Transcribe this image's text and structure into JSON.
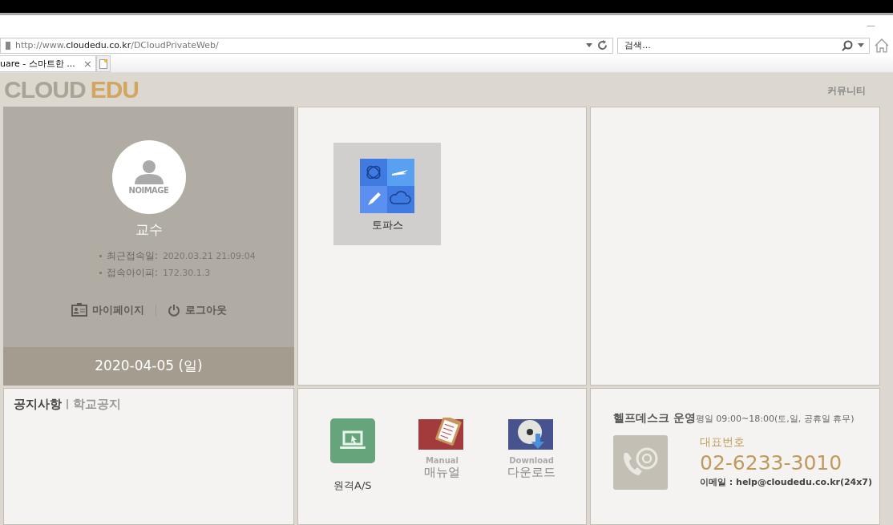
{
  "browser": {
    "minimize": "—",
    "url": "http://www.**cloudedu.co.kr**/DCloudPrivateWeb/",
    "search": {
      "placeholder": "검색..."
    },
    "tabs": [
      {
        "label": "uare - 스마트한 ...",
        "selected": true,
        "close": "×"
      }
    ]
  },
  "header": {
    "logo": [
      "CLOUD",
      "EDU"
    ],
    "nav": [
      "커뮤니티"
    ]
  },
  "profile": {
    "photo_text": "NOIMAGE",
    "name": "교수",
    "info": [
      {
        "label": "최근접속일:",
        "value": "2020.03.21 21:09:04"
      },
      {
        "label": "접속아이피:",
        "value": "172.30.1.3"
      }
    ],
    "links": [
      {
        "kind": "mypage",
        "label": "마이페이지"
      },
      {
        "kind": "logout",
        "label": "로그아웃"
      }
    ],
    "date": "2020-04-05 (일)"
  },
  "apps": [
    {
      "label": "토파스",
      "selected": true
    }
  ],
  "notice": {
    "title": "공지사항",
    "separator": "|",
    "subtitle": "학교공지"
  },
  "tools": [
    {
      "kind": "remote",
      "label": "원격A/S"
    },
    {
      "kind": "manual",
      "caption": "Manual",
      "label": "매뉴얼"
    },
    {
      "kind": "download",
      "caption": "Download",
      "label": "다운로드"
    }
  ],
  "helpdesk": {
    "title": "헬프데스크 운영",
    "hours": "평일 09:00~18:00(토,일, 공휴일 휴무)",
    "phone_label": "대표번호",
    "phone": "02-6233-3010",
    "email": "이메일 : help@cloudedu.co.kr(24x7)"
  }
}
